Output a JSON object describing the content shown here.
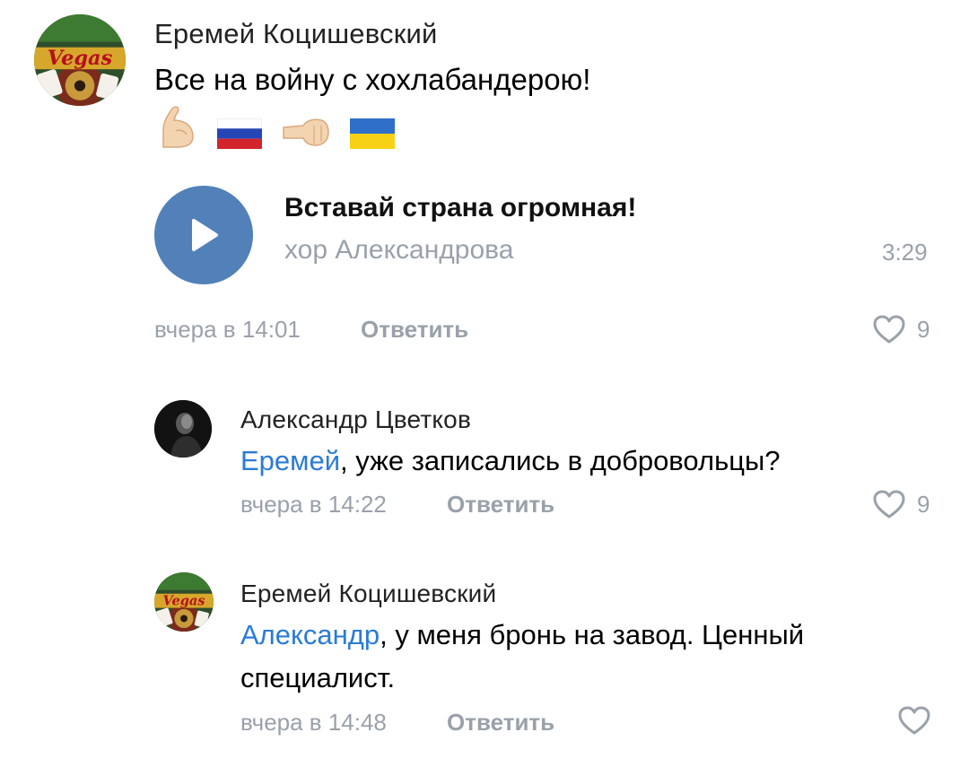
{
  "comments": [
    {
      "author": "Еремей Коцишевский",
      "text": "Все на войну с хохлабандерою!",
      "emojis": [
        "flexed-biceps-icon",
        "russia-flag-icon",
        "fist-punch-icon",
        "ukraine-flag-icon"
      ],
      "attachment": {
        "title": "Вставай страна огромная!",
        "artist": "хор Александрова",
        "duration": "3:29"
      },
      "time": "вчера в 14:01",
      "reply_label": "Ответить",
      "likes": "9"
    },
    {
      "author": "Александр Цветков",
      "mention": "Еремей",
      "text": ", уже записались в добровольцы?",
      "time": "вчера в 14:22",
      "reply_label": "Ответить",
      "likes": "9"
    },
    {
      "author": "Еремей Коцишевский",
      "mention": "Александр",
      "text_line1": ", у меня бронь на завод. Ценный",
      "text_line2": "специалист.",
      "time": "вчера в 14:48",
      "reply_label": "Ответить"
    }
  ],
  "avatar_label": "Vegas",
  "colors": {
    "accent": "#5181b8",
    "mention": "#2a7bd6",
    "meta": "#9aa1aa"
  }
}
